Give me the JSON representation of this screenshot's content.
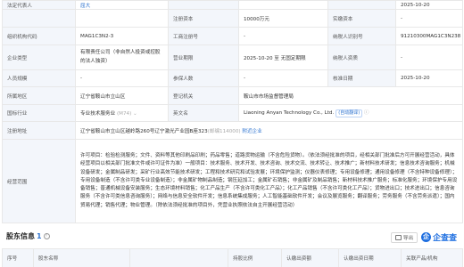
{
  "basic": {
    "legal_rep_label": "法定代表人",
    "legal_rep_value": "屈大",
    "approved_date_value": "2025-10-20",
    "reg_capital_label": "注册资本",
    "reg_capital_value": "10000万元",
    "paid_capital_label": "实缴资本",
    "paid_capital_value": "-",
    "org_code_label": "组织机构代码",
    "org_code_value": "MAG1C3N2-3",
    "biz_reg_no_label": "工商注册号",
    "biz_reg_no_value": "-",
    "taxpayer_id_label": "纳税人识别号",
    "taxpayer_id_value": "91210300MAG1C3N238",
    "company_type_label": "企业类型",
    "company_type_value": "有限责任公司（非自然人投资或控股的法人独资）",
    "business_term_label": "营业期限",
    "business_term_value": "2025-10-20 至 无固定期限",
    "taxpayer_quality_label": "纳税人资质",
    "taxpayer_quality_value": "-",
    "staff_size_label": "人员规模",
    "staff_size_value": "-",
    "insured_label": "参保人数",
    "insured_value": "-",
    "approval_date_label": "核准日期",
    "approval_date_value": "2025-10-20",
    "region_label": "所属地区",
    "region_value": "辽宁省鞍山市立山区",
    "authority_label": "登记机关",
    "authority_value": "鞍山市市场监督管理局",
    "industry_label": "国标行业",
    "industry_value": "专业技术服务业",
    "industry_code": "(M74)",
    "english_name_label": "英文名",
    "english_name_value": "Liaoning Anyan Technology Co., Ltd.",
    "english_name_tag": "(自动翻译)",
    "address_label": "注册地址",
    "address_value": "辽宁省鞍山市立山区越岭路260号辽宁激光产业园B座323",
    "address_postcode": "(邮编114000)",
    "address_link": "附近企业",
    "scope_label": "经营范围",
    "scope_value": "许可项目：检验检测服务；文件、资料等其他印刷品印刷；药品零售；道路货物运输（不含危险货物）。（依法须经批准的项目，经相关部门批准后方可开展经营活动，具体经营项目以相关部门批准文件或许可证件为准）一般项目：技术服务、技术开发、技术咨询、技术交流、技术转让、技术推广；新材料技术研发；信息技术咨询服务；机械设备研发；金属制品研发；采矿行业高效节能技术研发；工程和技术研究和试验发展；环境保护监测；仪器仪表修理；专用设备修理；通用设备修理（不含特种设备修理）；专用设备制造（不含许可类专业设备制造）；非金属矿物制品制造；钢压延加工；金属矿石销售；非金属矿及制品销售；新材料技术推广服务；标准化服务；环境保护专用设备销售；普通机械设备安装服务；生态环境材料销售；化工产品生产（不含许可类化工产品）；化工产品销售（不含许可类化工产品）；货物进出口；技术进出口；信息咨询服务（不含许可类信息咨询服务）；网络与信息安全软件开发；信息系统集成服务；人工智能基础软件开发；会议及展览服务；翻译服务；劳务服务（不含劳务派遣）；国内贸易代理；销售代理；物业管理。（除依法须经批准的项目外，凭营业执照依法自主开展经营活动）"
  },
  "section": {
    "title": "股东信息",
    "count": "1",
    "export_label": "导出",
    "logo_mark": "企",
    "logo_text": "企查查"
  },
  "shareholder_table": {
    "headers": [
      "序号",
      "股东名称",
      "",
      "持股比例",
      "认缴出资额",
      "认缴出资日期",
      "关联产品/机构"
    ]
  }
}
